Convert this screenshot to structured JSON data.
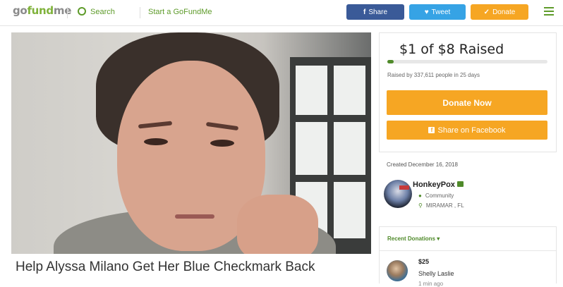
{
  "header": {
    "logo_prefix": "go",
    "logo_main": "fund",
    "logo_suffix": "me",
    "search_label": "Search",
    "start_label": "Start a GoFundMe",
    "share_label": "Share",
    "tweet_label": "Tweet",
    "donate_label": "Donate"
  },
  "campaign": {
    "title": "Help Alyssa Milano Get Her Blue Checkmark Back"
  },
  "sidebar": {
    "raised_text": "$1 of $8 Raised",
    "progress_fraction": 0.04,
    "raised_by": "Raised by 337,611 people in 25 days",
    "donate_now": "Donate Now",
    "share_facebook": "Share on Facebook",
    "created": "Created December 16, 2018",
    "organizer": {
      "name": "HonkeyPox",
      "category": "Community",
      "location": "MIRAMAR , FL"
    },
    "recent_donations_label": "Recent Donations",
    "donations": [
      {
        "amount": "$25",
        "name": "Shelly Laslie",
        "time": "1 min ago"
      }
    ]
  },
  "colors": {
    "brand_green": "#4f8a2a",
    "facebook_blue": "#3a5a98",
    "twitter_blue": "#36a3e5",
    "donate_orange": "#f6a623"
  }
}
